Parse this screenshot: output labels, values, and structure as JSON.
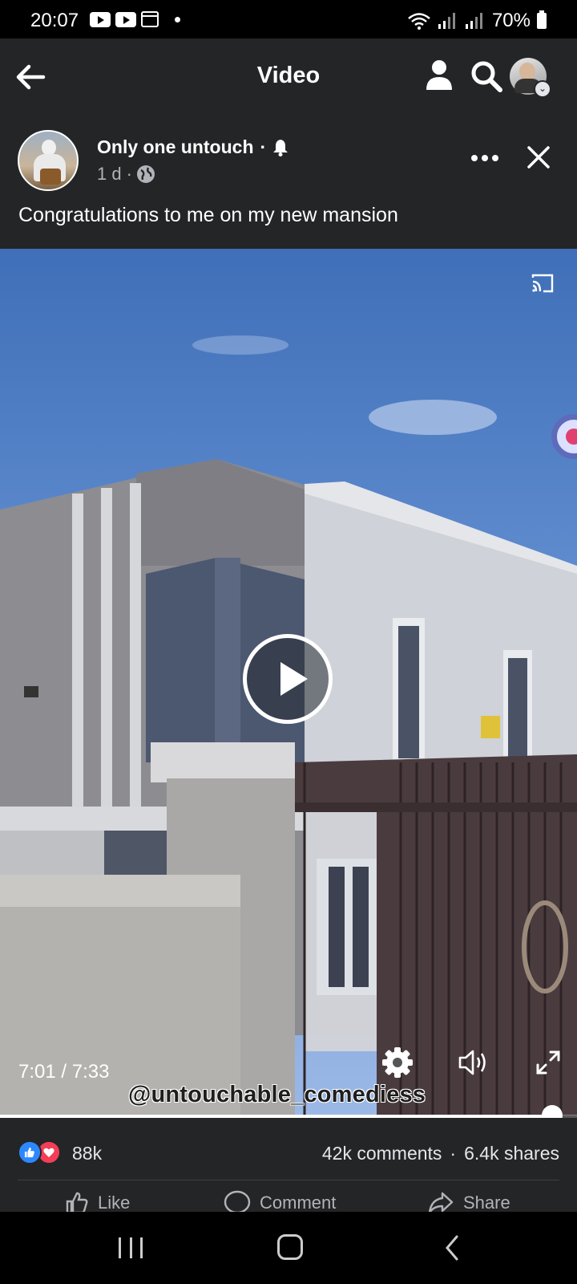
{
  "status_bar": {
    "time": "20:07",
    "battery": "70%"
  },
  "header": {
    "title": "Video"
  },
  "post": {
    "author": "Only one untouch",
    "author_separator": "·",
    "time_ago": "1 d",
    "meta_separator": "·",
    "caption": "Congratulations to me on my new mansion"
  },
  "video": {
    "current_time": "7:01 / 7:33",
    "watermark": "@untouchable_comediess",
    "progress_fraction": 0.957
  },
  "engagement": {
    "reaction_count": "88k",
    "comments": "42k comments",
    "separator": "·",
    "shares": "6.4k shares"
  },
  "actions": {
    "like": "Like",
    "comment": "Comment",
    "share": "Share"
  },
  "colors": {
    "header_bg": "#242526",
    "like_blue": "#2d88ff",
    "love_red": "#f33e58"
  }
}
